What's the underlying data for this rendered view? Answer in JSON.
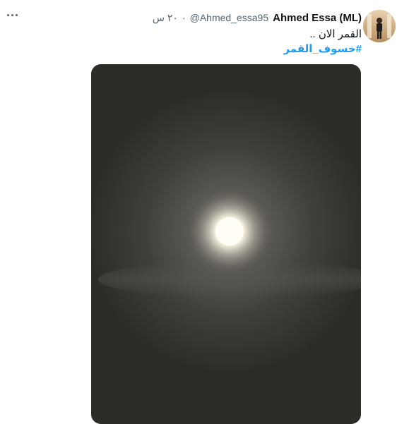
{
  "tweet": {
    "author_name": "Ahmed Essa (ML)",
    "handle": "@Ahmed_essa95",
    "separator": "·",
    "time": "٢٠ س",
    "text": "القمر الان ..",
    "hashtag": "#خسوف_القمر"
  },
  "icons": {
    "more": "more-horizontal-icon",
    "avatar": "profile-avatar"
  },
  "colors": {
    "accent": "#1d9bf0",
    "secondary_text": "#536471",
    "primary_text": "#0f1419"
  }
}
